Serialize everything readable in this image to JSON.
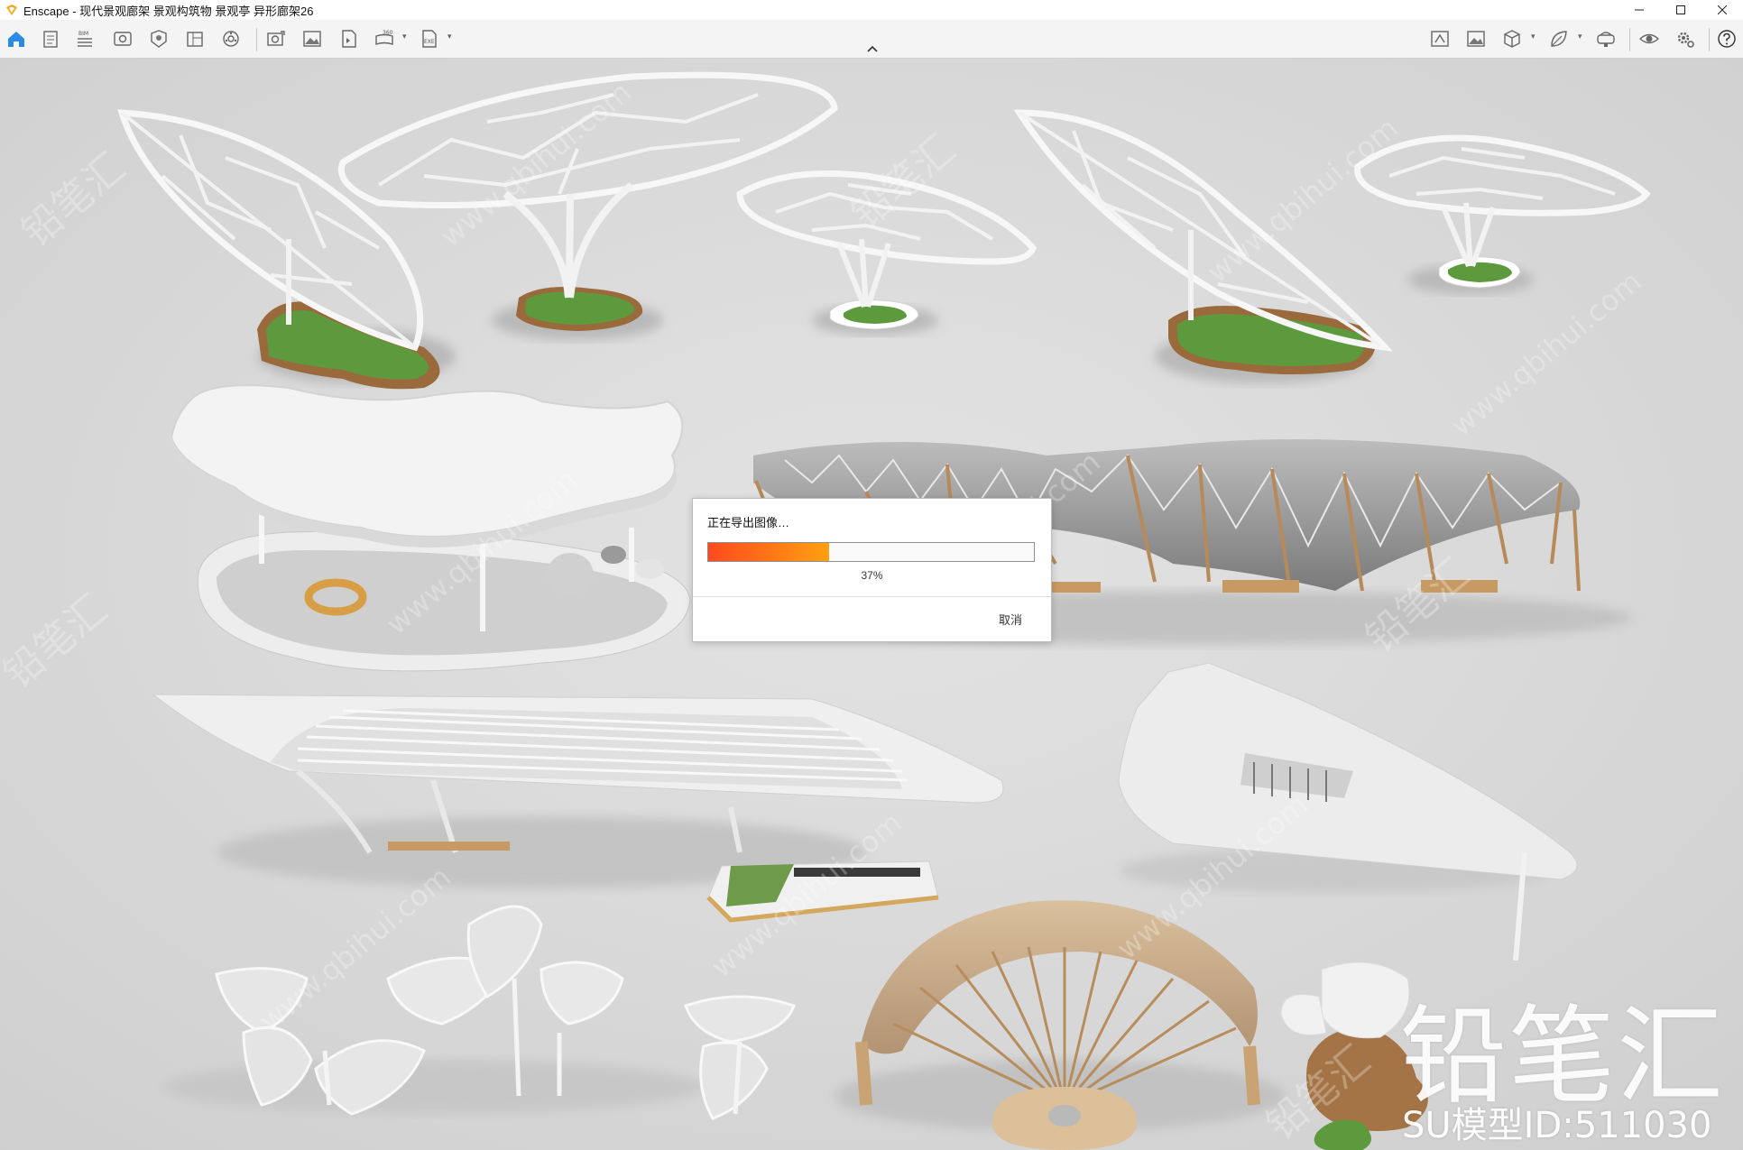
{
  "window": {
    "title": "Enscape - 现代景观廊架 景观构筑物 景观亭 异形廊架26",
    "controls": [
      "minimize",
      "maximize",
      "close"
    ]
  },
  "toolbar": {
    "left_icons": [
      "home-icon",
      "document-icon",
      "bim-icon",
      "visual-settings-icon",
      "asset-icon",
      "layers-icon",
      "sun-icon",
      "screenshot-icon",
      "image-export-icon",
      "batch-render-icon",
      "panorama-icon",
      "exe-export-icon"
    ],
    "bim_label": "BIM",
    "panorama_label": "360",
    "exe_label": "EXE",
    "right_icons": [
      "view-management-icon",
      "image-icon",
      "cube-icon",
      "leaf-icon",
      "vr-icon",
      "eye-icon",
      "settings-icon",
      "help-icon"
    ]
  },
  "dialog": {
    "title": "正在导出图像…",
    "progress_percent": 37,
    "progress_label": "37%",
    "cancel_label": "取消",
    "colors": {
      "bar_start": "#ff4a1f",
      "bar_end": "#ffa010"
    }
  },
  "watermark": {
    "brand": "铅笔汇",
    "model_id": "SU模型ID:511030",
    "repeat_text_cn": "铅笔汇",
    "repeat_text_url": "www.qbihui.com"
  }
}
